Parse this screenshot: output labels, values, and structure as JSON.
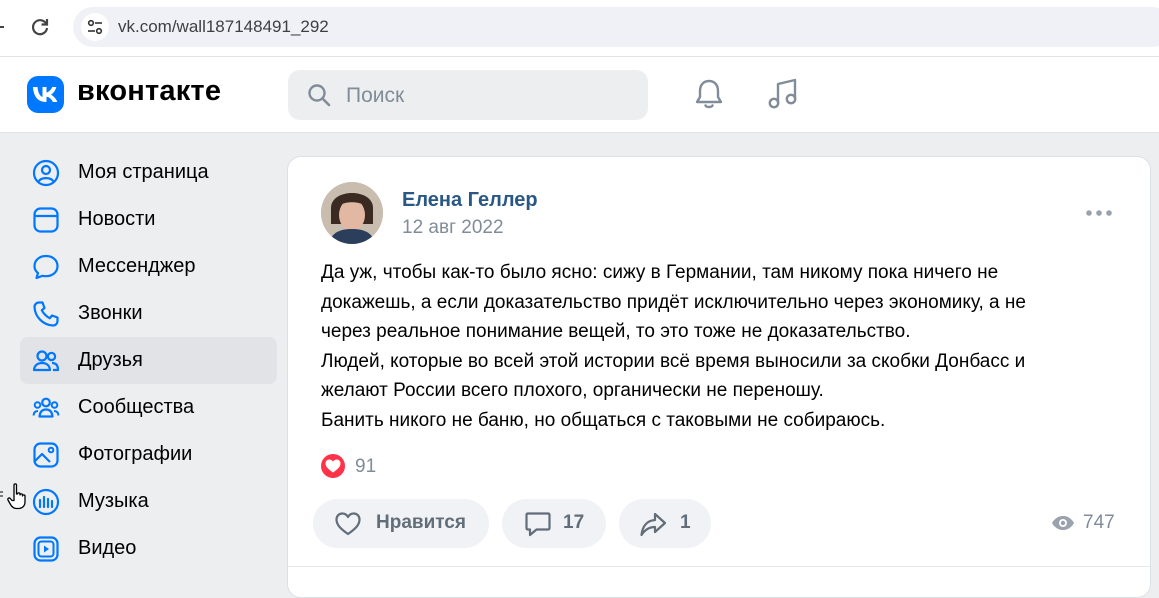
{
  "browser": {
    "url": "vk.com/wall187148491_292"
  },
  "header": {
    "logo_text": "вконтакте",
    "search_placeholder": "Поиск",
    "icons": [
      "vk-logo-icon",
      "search-icon",
      "bell-icon",
      "music-icon"
    ]
  },
  "sidebar": {
    "items": [
      {
        "label": "Моя страница",
        "icon": "user-circle-icon"
      },
      {
        "label": "Новости",
        "icon": "news-icon"
      },
      {
        "label": "Мессенджер",
        "icon": "chat-bubble-icon"
      },
      {
        "label": "Звонки",
        "icon": "phone-icon"
      },
      {
        "label": "Друзья",
        "icon": "friends-icon",
        "active": true
      },
      {
        "label": "Сообщества",
        "icon": "communities-icon"
      },
      {
        "label": "Фотографии",
        "icon": "photo-icon"
      },
      {
        "label": "Музыка",
        "icon": "music-bars-icon"
      },
      {
        "label": "Видео",
        "icon": "video-icon"
      }
    ]
  },
  "post": {
    "author": "Елена Геллер",
    "date": "12 авг 2022",
    "text_lines": [
      "Да уж, чтобы как-то было ясно: сижу в Германии, там никому пока ничего не",
      "докажешь, а если доказательство придёт исключительно через экономику, а не",
      "через реальное понимание вещей, то это тоже не доказательство.",
      "Людей, которые во всей этой истории всё время выносили за скобки Донбасс и",
      "желают России всего плохого, органически не переношу.",
      "Банить никого не баню, но общаться с таковыми не собираюсь."
    ],
    "reactions_count": "91",
    "actions": {
      "like_label": "Нравится",
      "comments_count": "17",
      "shares_count": "1",
      "views_count": "747"
    }
  },
  "colors": {
    "accent": "#0077ff",
    "link": "#2a5885",
    "page_bg": "#edeef0",
    "secondary_text": "#818c99",
    "reaction": "#ff3347"
  }
}
